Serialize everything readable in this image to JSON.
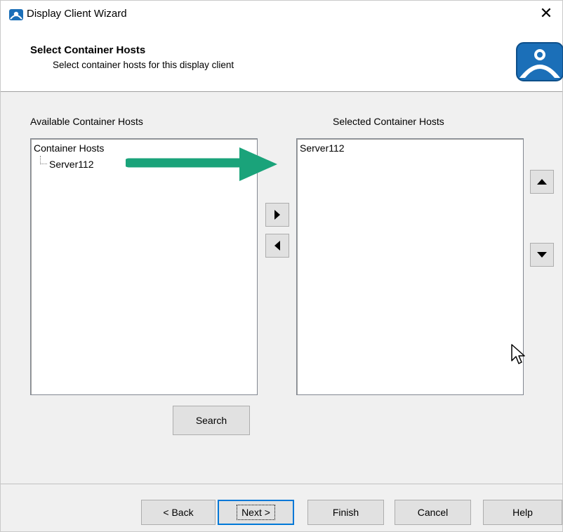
{
  "window": {
    "title": "Display Client Wizard",
    "close_label": "✕"
  },
  "header": {
    "title": "Select Container Hosts",
    "subtitle": "Select container hosts for this display client"
  },
  "available": {
    "label": "Available Container Hosts",
    "tree": {
      "root": "Container Hosts",
      "children": [
        "Server112"
      ]
    }
  },
  "selected": {
    "label": "Selected Container Hosts",
    "items": [
      "Server112"
    ]
  },
  "buttons": {
    "search": "Search",
    "back": "< Back",
    "next": "Next >",
    "finish": "Finish",
    "cancel": "Cancel",
    "help": "Help"
  },
  "icons": {
    "add": "right-triangle-icon",
    "remove": "left-triangle-icon",
    "move_up": "up-triangle-icon",
    "move_down": "down-triangle-icon",
    "annotation_arrow_color": "#1aa37a",
    "logo_color": "#1b6fb8"
  }
}
